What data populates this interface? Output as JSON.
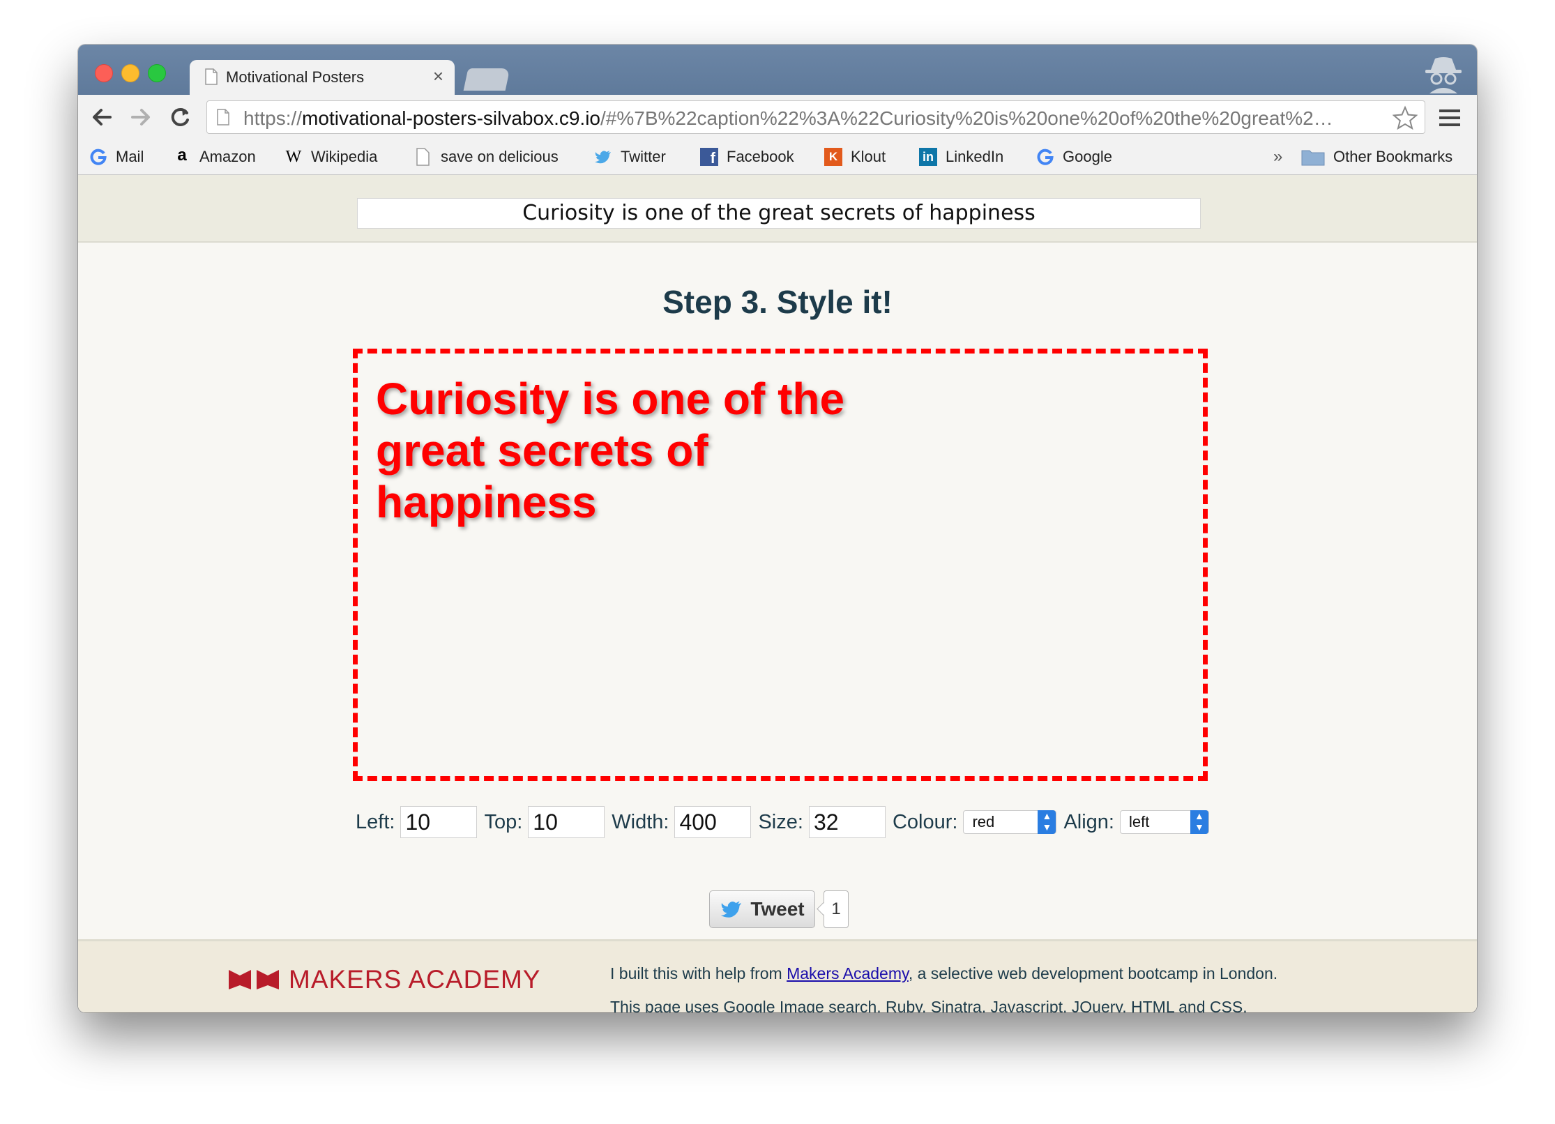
{
  "browser": {
    "tab_title": "Motivational Posters",
    "tab_close": "×",
    "url_prefix": "https://",
    "url_host": "motivational-posters-silvabox.c9.io",
    "url_rest": "/#%7B%22caption%22%3A%22Curiosity%20is%20one%20of%20the%20great%2…",
    "bookmarks": [
      {
        "label": "Mail",
        "icon": "google-icon"
      },
      {
        "label": "Amazon",
        "icon": "amazon-icon"
      },
      {
        "label": "Wikipedia",
        "icon": "wikipedia-icon"
      },
      {
        "label": "save on delicious",
        "icon": "page-icon"
      },
      {
        "label": "Twitter",
        "icon": "twitter-icon"
      },
      {
        "label": "Facebook",
        "icon": "facebook-icon"
      },
      {
        "label": "Klout",
        "icon": "klout-icon"
      },
      {
        "label": "LinkedIn",
        "icon": "linkedin-icon"
      },
      {
        "label": "Google",
        "icon": "google-icon"
      }
    ],
    "overflow_chevron": "»",
    "other_bookmarks": "Other Bookmarks"
  },
  "page": {
    "caption_input_value": "Curiosity is one of the great secrets of happiness",
    "step_title": "Step 3. Style it!",
    "poster_text": "Curiosity is one of the great secrets of happiness",
    "poster_color": "#ff0000",
    "controls": {
      "left_label": "Left:",
      "left_value": "10",
      "top_label": "Top:",
      "top_value": "10",
      "width_label": "Width:",
      "width_value": "400",
      "size_label": "Size:",
      "size_value": "32",
      "colour_label": "Colour:",
      "colour_value": "red",
      "align_label": "Align:",
      "align_value": "left"
    },
    "tweet_label": "Tweet",
    "tweet_count": "1"
  },
  "footer": {
    "logo_text": "MAKERS ACADEMY",
    "line1_before": "I built this with help from ",
    "line1_link": "Makers Academy",
    "line1_after": ", a selective web development bootcamp in London.",
    "line2": "This page uses Google Image search, Ruby, Sinatra, Javascript, JQuery, HTML and CSS."
  }
}
